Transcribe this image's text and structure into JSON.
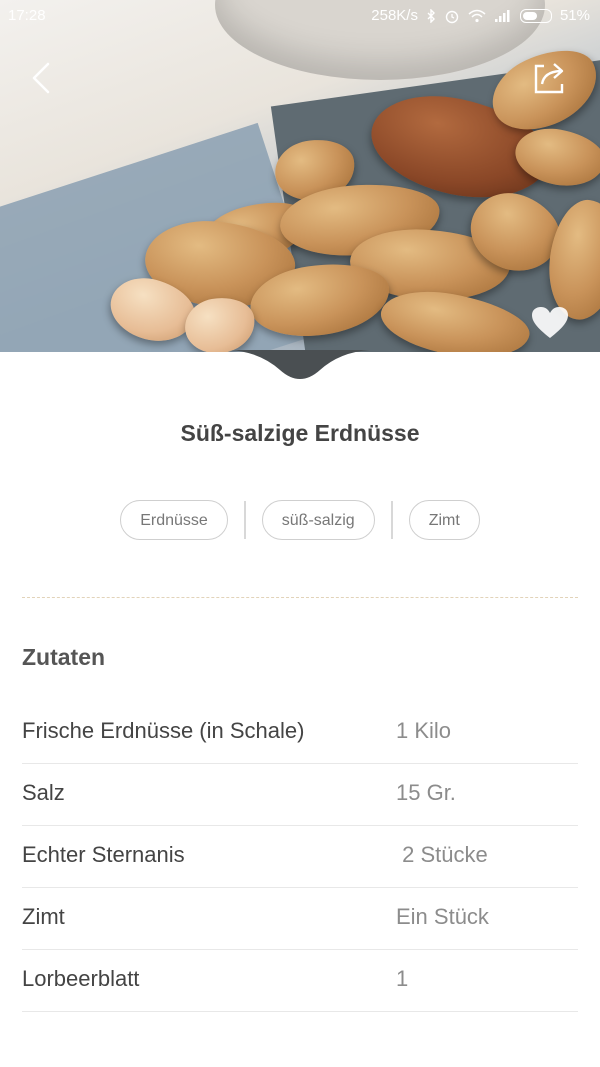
{
  "status_bar": {
    "time": "17:28",
    "net_speed": "258K/s",
    "battery": "51%"
  },
  "recipe": {
    "title": "Süß-salzige Erdnüsse",
    "tags": [
      "Erdnüsse",
      "süß-salzig",
      "Zimt"
    ]
  },
  "ingredients": {
    "section_title": "Zutaten",
    "items": [
      {
        "name": "Frische Erdnüsse (in Schale)",
        "amount": "1 Kilo"
      },
      {
        "name": "Salz",
        "amount": "15 Gr."
      },
      {
        "name": "Echter Sternanis",
        "amount": " 2 Stücke"
      },
      {
        "name": "Zimt",
        "amount": "Ein Stück"
      },
      {
        "name": "Lorbeerblatt",
        "amount": "1"
      }
    ]
  },
  "icons": {
    "back": "chevron-left-icon",
    "share": "share-icon",
    "favorite": "heart-icon"
  },
  "colors": {
    "title_text": "#444444",
    "amount_text": "#8c8c8c",
    "divider_dashed": "#e2d3b9"
  }
}
